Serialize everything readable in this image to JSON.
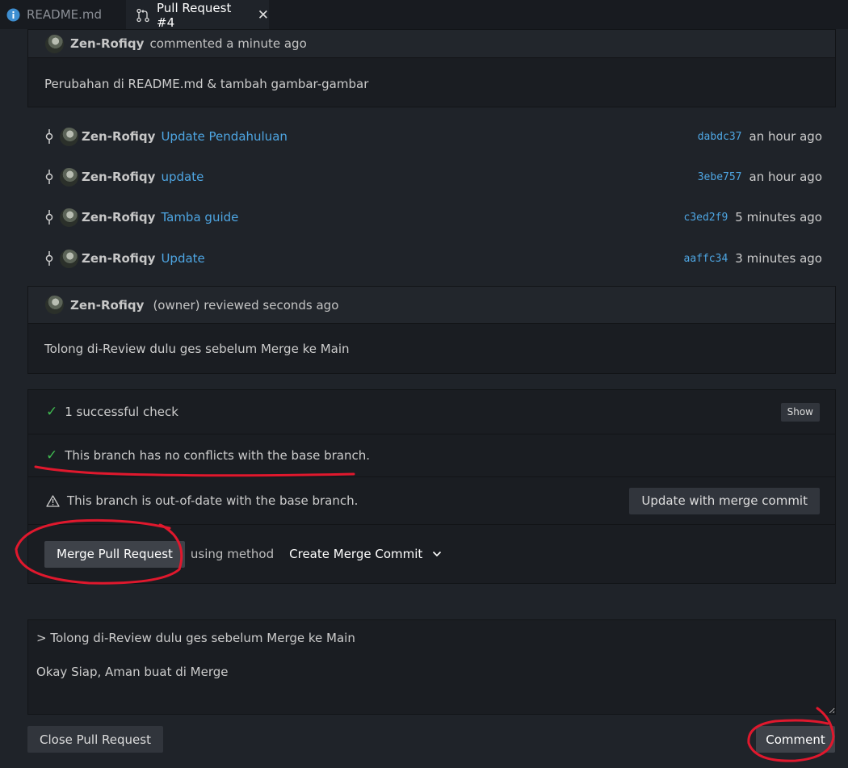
{
  "tabs": [
    {
      "label": "README.md",
      "icon": "info-icon"
    },
    {
      "label": "Pull Request #4",
      "icon": "pull-request-icon",
      "close": "✕"
    }
  ],
  "description": {
    "author": "Zen-Rofiqy",
    "action": "commented a minute ago",
    "body": "Perubahan di README.md & tambah gambar-gambar"
  },
  "commits": [
    {
      "author": "Zen-Rofiqy",
      "message": "Update Pendahuluan",
      "sha": "dabdc37",
      "time": "an hour ago"
    },
    {
      "author": "Zen-Rofiqy",
      "message": "update",
      "sha": "3ebe757",
      "time": "an hour ago"
    },
    {
      "author": "Zen-Rofiqy",
      "message": "Tamba guide",
      "sha": "c3ed2f9",
      "time": "5 minutes ago"
    },
    {
      "author": "Zen-Rofiqy",
      "message": "Update",
      "sha": "aaffc34",
      "time": "3 minutes ago"
    }
  ],
  "review": {
    "author": "Zen-Rofiqy",
    "action": "(owner) reviewed seconds ago",
    "body": "Tolong di-Review dulu ges sebelum Merge ke Main"
  },
  "checks": {
    "successful": "1 successful check",
    "show_label": "Show",
    "no_conflicts": "This branch has no conflicts with the base branch.",
    "out_of_date": "This branch is out-of-date with the base branch.",
    "update_button": "Update with merge commit",
    "merge_button": "Merge Pull Request",
    "using_method": "using method",
    "method_selected": "Create Merge Commit"
  },
  "comment_box": {
    "value": "> Tolong di-Review dulu ges sebelum Merge ke Main\n\nOkay Siap, Aman buat di Merge"
  },
  "footer": {
    "close_button": "Close Pull Request",
    "comment_button": "Comment"
  },
  "colors": {
    "background": "#1f2329",
    "panel": "#1a1d22",
    "link": "#4ea6e3",
    "success": "#3fb950",
    "annotation": "#e0182d"
  }
}
